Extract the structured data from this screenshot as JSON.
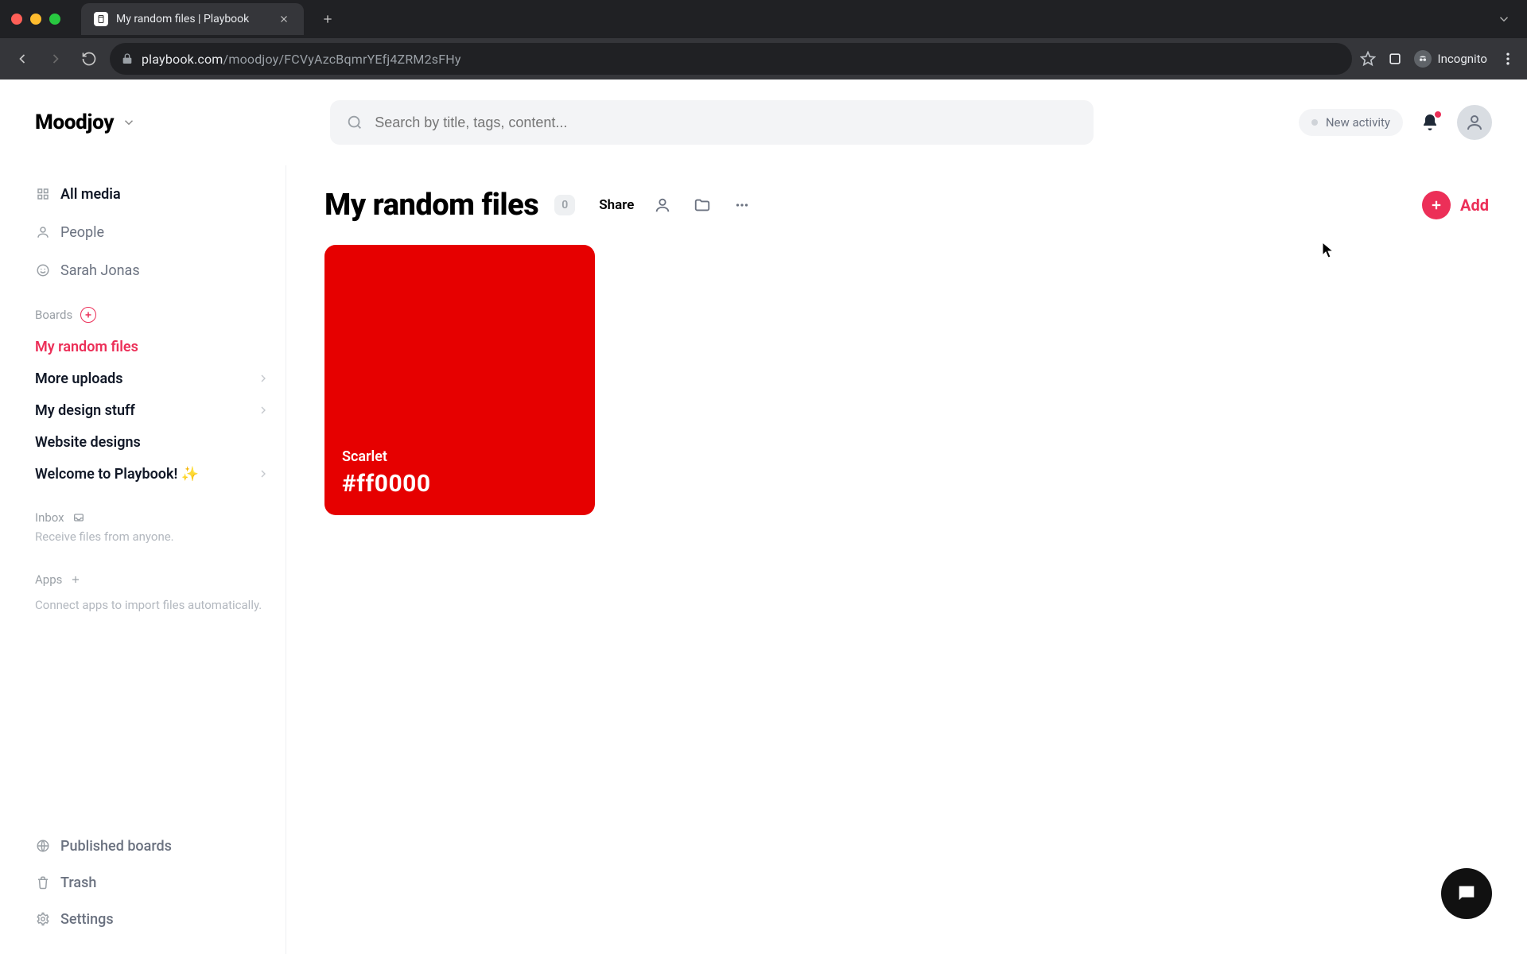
{
  "browser": {
    "tab_title": "My random files | Playbook",
    "url_host": "playbook.com",
    "url_path": "/moodjoy/FCVyAzcBqmrYEfj4ZRM2sFHy",
    "incognito_label": "Incognito"
  },
  "header": {
    "workspace": "Moodjoy",
    "search_placeholder": "Search by title, tags, content...",
    "new_activity": "New activity"
  },
  "sidebar": {
    "nav": {
      "all_media": "All media",
      "people": "People",
      "user_name": "Sarah Jonas"
    },
    "boards_label": "Boards",
    "boards": [
      {
        "label": "My random files",
        "active": true,
        "expandable": false
      },
      {
        "label": "More uploads",
        "active": false,
        "expandable": true
      },
      {
        "label": "My design stuff",
        "active": false,
        "expandable": true
      },
      {
        "label": "Website designs",
        "active": false,
        "expandable": false
      },
      {
        "label": "Welcome to Playbook! ✨",
        "active": false,
        "expandable": true
      }
    ],
    "inbox": {
      "label": "Inbox",
      "subtitle": "Receive files from anyone."
    },
    "apps": {
      "label": "Apps",
      "subtitle": "Connect apps to import files automatically."
    },
    "bottom": {
      "published": "Published boards",
      "trash": "Trash",
      "settings": "Settings"
    }
  },
  "page": {
    "title": "My random files",
    "count": "0",
    "share": "Share",
    "add": "Add"
  },
  "cards": [
    {
      "name": "Scarlet",
      "hex": "#ff0000",
      "bg": "#e60000"
    }
  ]
}
